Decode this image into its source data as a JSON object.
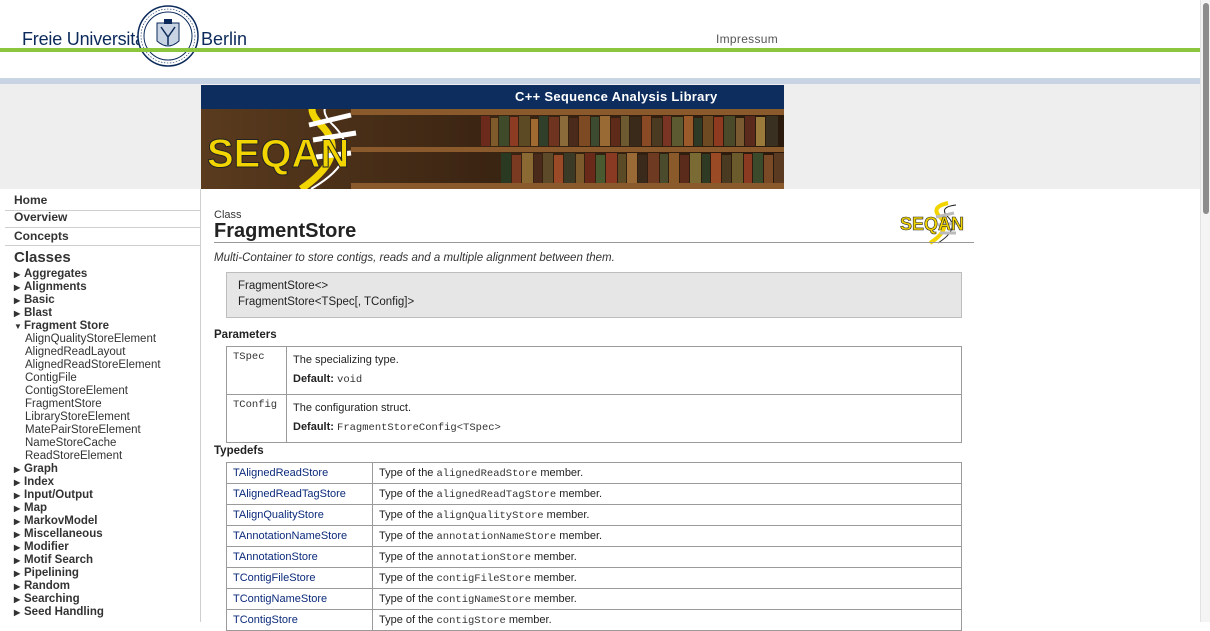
{
  "header": {
    "university_left": "Freie Universität",
    "university_right": "Berlin",
    "impressum": "Impressum",
    "colors": {
      "green": "#8cc63f",
      "navy": "#0c2d5e"
    }
  },
  "banner": {
    "title": "C++ Sequence Analysis Library",
    "logo_text": "SEQAN"
  },
  "sidebar": {
    "top_links": [
      "Home",
      "Overview",
      "Concepts"
    ],
    "classes_heading": "Classes",
    "items": [
      {
        "label": "Aggregates",
        "type": "group",
        "expanded": false
      },
      {
        "label": "Alignments",
        "type": "group",
        "expanded": false
      },
      {
        "label": "Basic",
        "type": "group",
        "expanded": false
      },
      {
        "label": "Blast",
        "type": "group",
        "expanded": false
      },
      {
        "label": "Fragment Store",
        "type": "group",
        "expanded": true
      },
      {
        "label": "AlignQualityStoreElement",
        "type": "sub"
      },
      {
        "label": "AlignedReadLayout",
        "type": "sub"
      },
      {
        "label": "AlignedReadStoreElement",
        "type": "sub"
      },
      {
        "label": "ContigFile",
        "type": "sub"
      },
      {
        "label": "ContigStoreElement",
        "type": "sub"
      },
      {
        "label": "FragmentStore",
        "type": "sub"
      },
      {
        "label": "LibraryStoreElement",
        "type": "sub"
      },
      {
        "label": "MatePairStoreElement",
        "type": "sub"
      },
      {
        "label": "NameStoreCache",
        "type": "sub"
      },
      {
        "label": "ReadStoreElement",
        "type": "sub"
      },
      {
        "label": "Graph",
        "type": "group",
        "expanded": false
      },
      {
        "label": "Index",
        "type": "group",
        "expanded": false
      },
      {
        "label": "Input/Output",
        "type": "group",
        "expanded": false
      },
      {
        "label": "Map",
        "type": "group",
        "expanded": false
      },
      {
        "label": "MarkovModel",
        "type": "group",
        "expanded": false
      },
      {
        "label": "Miscellaneous",
        "type": "group",
        "expanded": false
      },
      {
        "label": "Modifier",
        "type": "group",
        "expanded": false
      },
      {
        "label": "Motif Search",
        "type": "group",
        "expanded": false
      },
      {
        "label": "Pipelining",
        "type": "group",
        "expanded": false
      },
      {
        "label": "Random",
        "type": "group",
        "expanded": false
      },
      {
        "label": "Searching",
        "type": "group",
        "expanded": false
      },
      {
        "label": "Seed Handling",
        "type": "group",
        "expanded": false
      }
    ]
  },
  "main": {
    "kind": "Class",
    "title": "FragmentStore",
    "description": "Multi-Container to store contigs, reads and a multiple alignment between them.",
    "signatures": [
      "FragmentStore<>",
      "FragmentStore<TSpec[, TConfig]>"
    ],
    "parameters_heading": "Parameters",
    "default_label": "Default:",
    "parameters": [
      {
        "name": "TSpec",
        "desc": "The specializing type.",
        "default": "void"
      },
      {
        "name": "TConfig",
        "desc": "The configuration struct.",
        "default": "FragmentStoreConfig<TSpec>"
      }
    ],
    "typedefs_heading": "Typedefs",
    "typedefs": [
      {
        "name": "TAlignedReadStore",
        "prefix": "Type of the ",
        "member": "alignedReadStore",
        "suffix": " member."
      },
      {
        "name": "TAlignedReadTagStore",
        "prefix": "Type of the ",
        "member": "alignedReadTagStore",
        "suffix": " member."
      },
      {
        "name": "TAlignQualityStore",
        "prefix": "Type of the ",
        "member": "alignQualityStore",
        "suffix": " member."
      },
      {
        "name": "TAnnotationNameStore",
        "prefix": "Type of the ",
        "member": "annotationNameStore",
        "suffix": " member."
      },
      {
        "name": "TAnnotationStore",
        "prefix": "Type of the ",
        "member": "annotationStore",
        "suffix": " member."
      },
      {
        "name": "TContigFileStore",
        "prefix": "Type of the ",
        "member": "contigFileStore",
        "suffix": " member."
      },
      {
        "name": "TContigNameStore",
        "prefix": "Type of the ",
        "member": "contigNameStore",
        "suffix": " member."
      },
      {
        "name": "TContigStore",
        "prefix": "Type of the ",
        "member": "contigStore",
        "suffix": " member."
      }
    ]
  }
}
